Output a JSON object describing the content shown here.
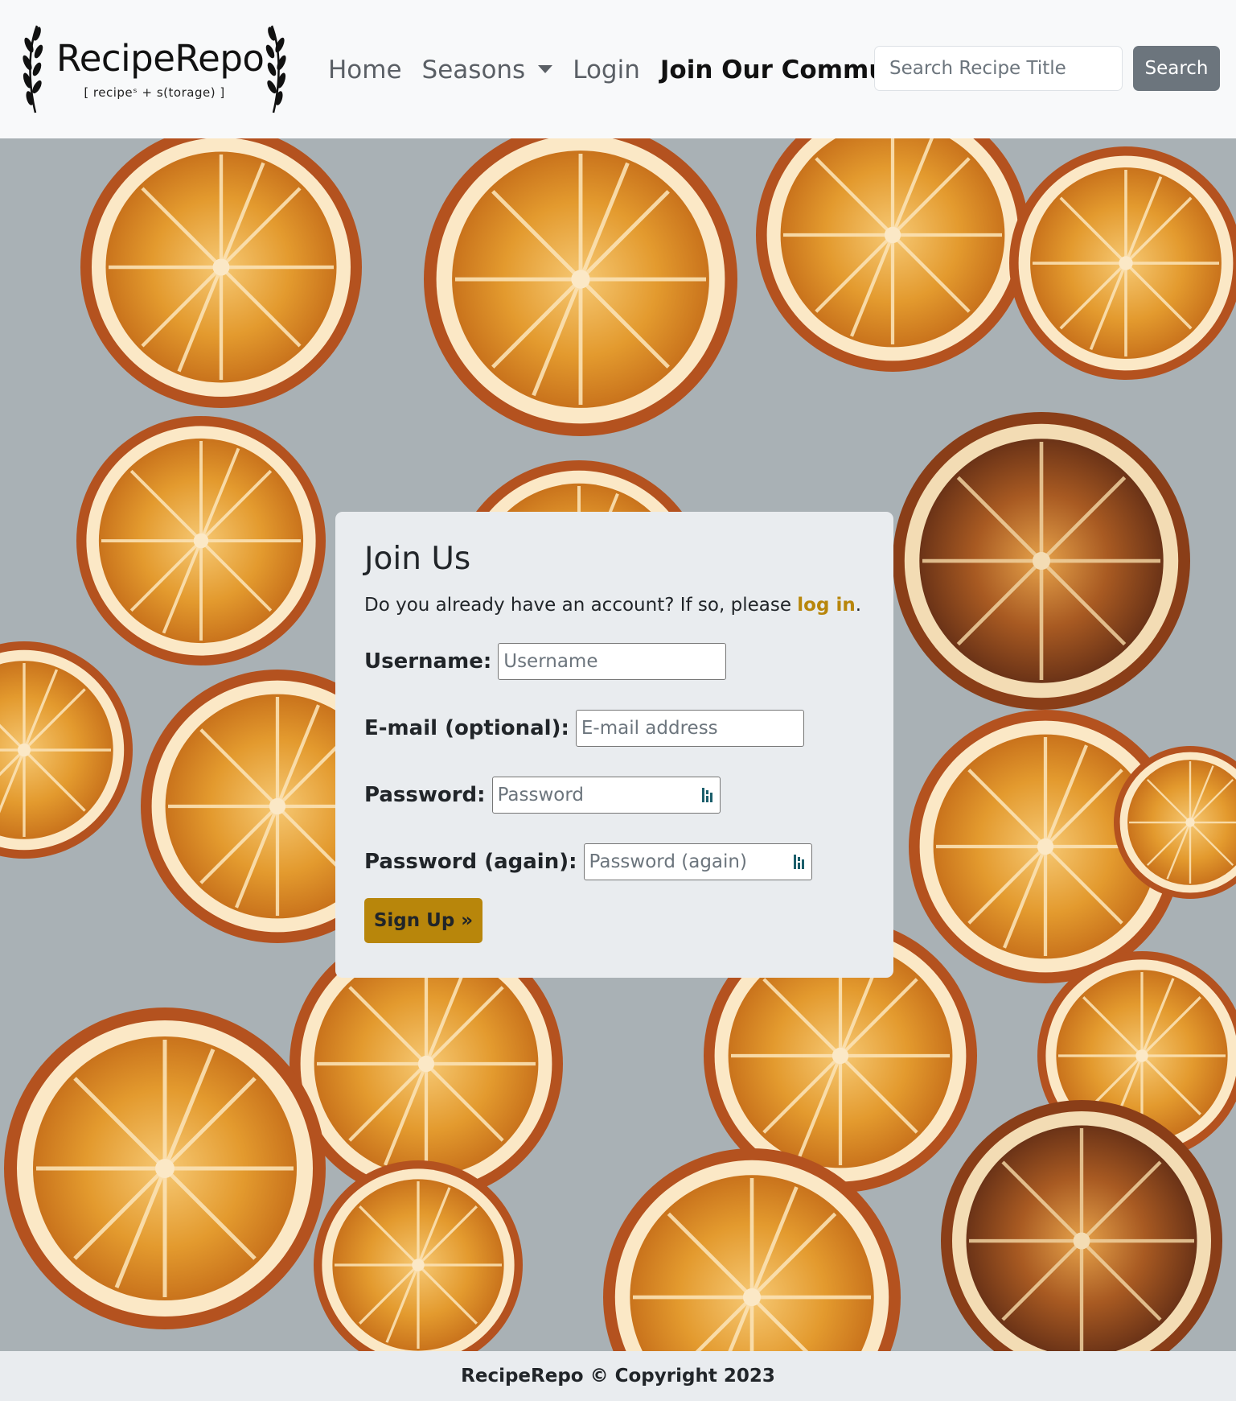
{
  "brand": {
    "title": "RecipeRepo",
    "tagline": "[ recipeˢ + s(torage) ]"
  },
  "nav": {
    "items": [
      {
        "label": "Home"
      },
      {
        "label": "Seasons"
      },
      {
        "label": "Login"
      },
      {
        "label": "Join Our Community"
      }
    ]
  },
  "search": {
    "placeholder": "Search Recipe Title",
    "button_label": "Search"
  },
  "signup": {
    "title": "Join Us",
    "intro_before": "Do you already have an account? If so, please ",
    "intro_link": "log in",
    "intro_after": ".",
    "fields": {
      "username": {
        "label": "Username:",
        "placeholder": "Username"
      },
      "email": {
        "label": "E-mail (optional):",
        "placeholder": "E-mail address"
      },
      "password": {
        "label": "Password:",
        "placeholder": "Password"
      },
      "password2": {
        "label": "Password (again):",
        "placeholder": "Password (again)"
      }
    },
    "button_label": "Sign Up »"
  },
  "footer": {
    "text": "RecipeRepo © Copyright 2023"
  },
  "colors": {
    "accent": "#b8860b",
    "search_button": "#6c757d",
    "navbar_bg": "#f8f9fa",
    "card_bg": "#e9ecef"
  }
}
